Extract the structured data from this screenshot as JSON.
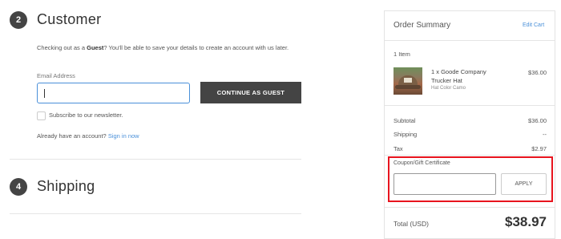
{
  "checkout": {
    "customer": {
      "step_number": "2",
      "title": "Customer",
      "guest_text_prefix": "Checking out as a ",
      "guest_word": "Guest",
      "guest_text_suffix": "? You'll be able to save your details to create an account with us later.",
      "email_label": "Email Address",
      "email_value": "",
      "continue_button": "CONTINUE AS GUEST",
      "subscribe_label": "Subscribe to our newsletter.",
      "subscribe_checked": false,
      "account_prompt": "Already have an account?",
      "signin_link": "Sign in now"
    },
    "shipping": {
      "step_number": "4",
      "title": "Shipping"
    }
  },
  "summary": {
    "title": "Order Summary",
    "edit_cart": "Edit Cart",
    "item_count": "1 Item",
    "item": {
      "name": "1 x Goode Company Trucker Hat",
      "option": "Hat Color Camo",
      "price": "$36.00"
    },
    "subtotal_label": "Subtotal",
    "subtotal_value": "$36.00",
    "shipping_label": "Shipping",
    "shipping_value": "--",
    "tax_label": "Tax",
    "tax_value": "$2.97",
    "coupon_label": "Coupon/Gift Certificate",
    "coupon_value": "",
    "apply_button": "APPLY",
    "total_label": "Total (USD)",
    "total_value": "$38.97"
  },
  "colors": {
    "accent_link": "#4a90d9",
    "button_dark": "#444444",
    "highlight_red": "#e8141e"
  }
}
